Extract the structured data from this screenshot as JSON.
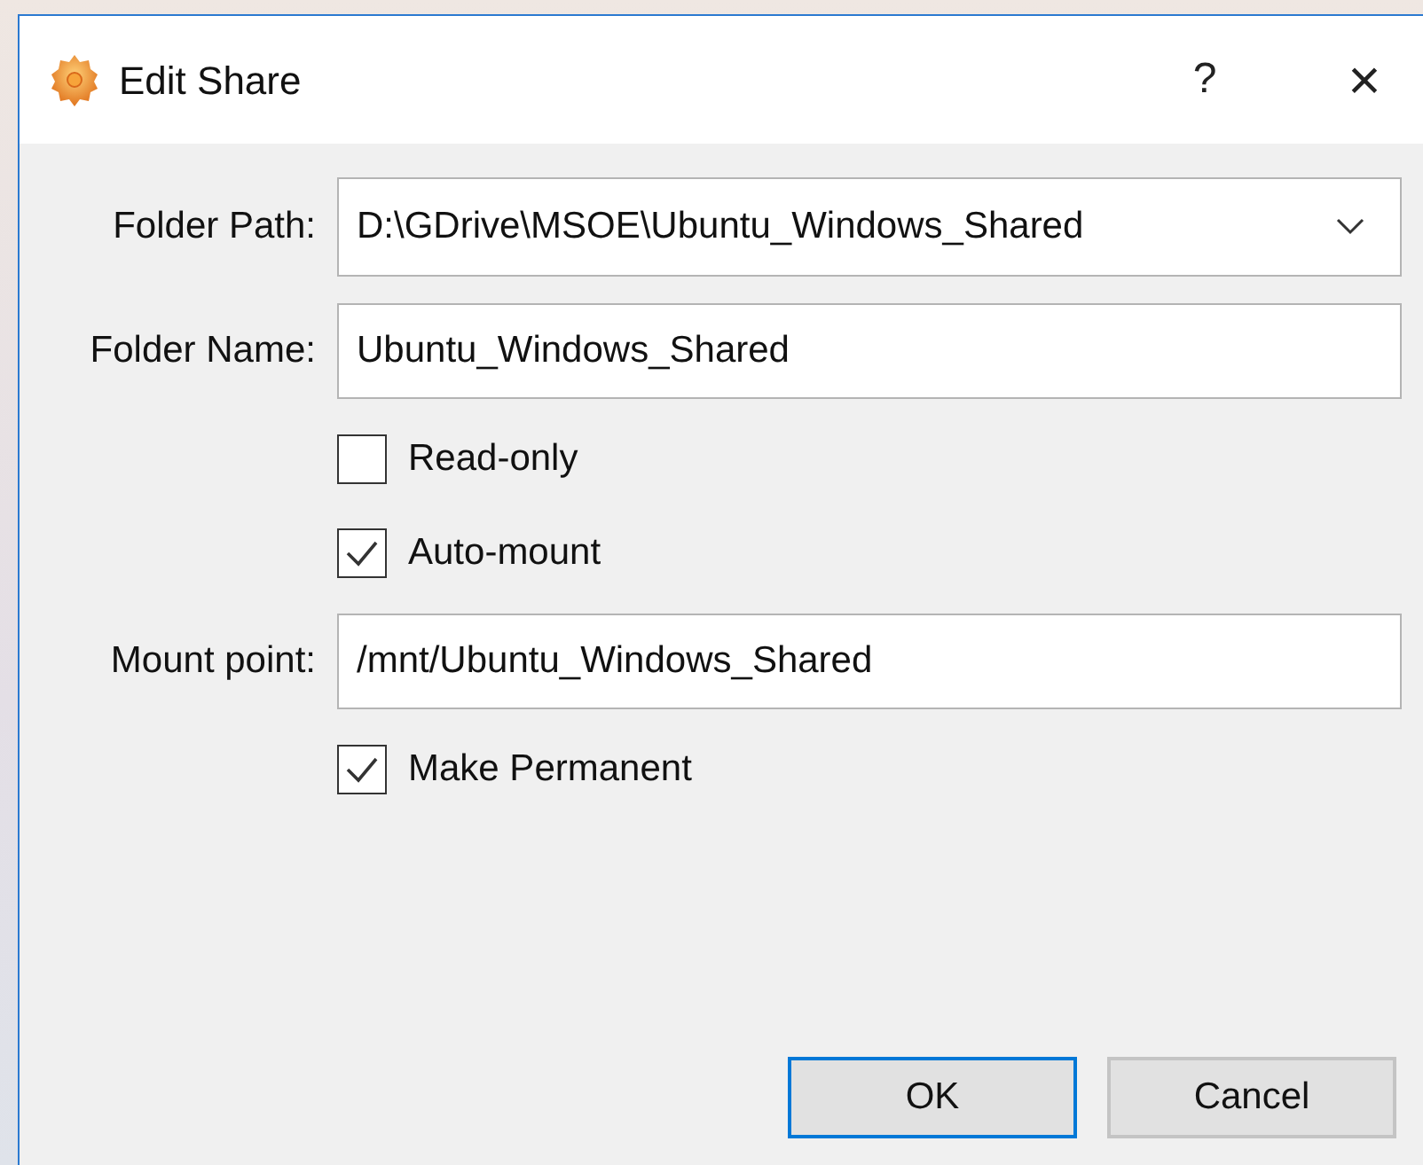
{
  "window": {
    "title": "Edit Share",
    "help_button": "?",
    "close_button": "×"
  },
  "fields": [
    {
      "kind": "combo",
      "label": "Folder Path:",
      "value": "D:\\GDrive\\MSOE\\Ubuntu_Windows_Shared"
    },
    {
      "kind": "text",
      "label": "Folder Name:",
      "value": "Ubuntu_Windows_Shared"
    },
    {
      "kind": "checkbox",
      "label": "Read-only",
      "checked": false
    },
    {
      "kind": "checkbox",
      "label": "Auto-mount",
      "checked": true
    },
    {
      "kind": "text",
      "label": "Mount point:",
      "value": "/mnt/Ubuntu_Windows_Shared"
    },
    {
      "kind": "checkbox",
      "label": "Make Permanent",
      "checked": true
    }
  ],
  "buttons": [
    {
      "label": "OK",
      "default": true
    },
    {
      "label": "Cancel",
      "default": false
    }
  ]
}
